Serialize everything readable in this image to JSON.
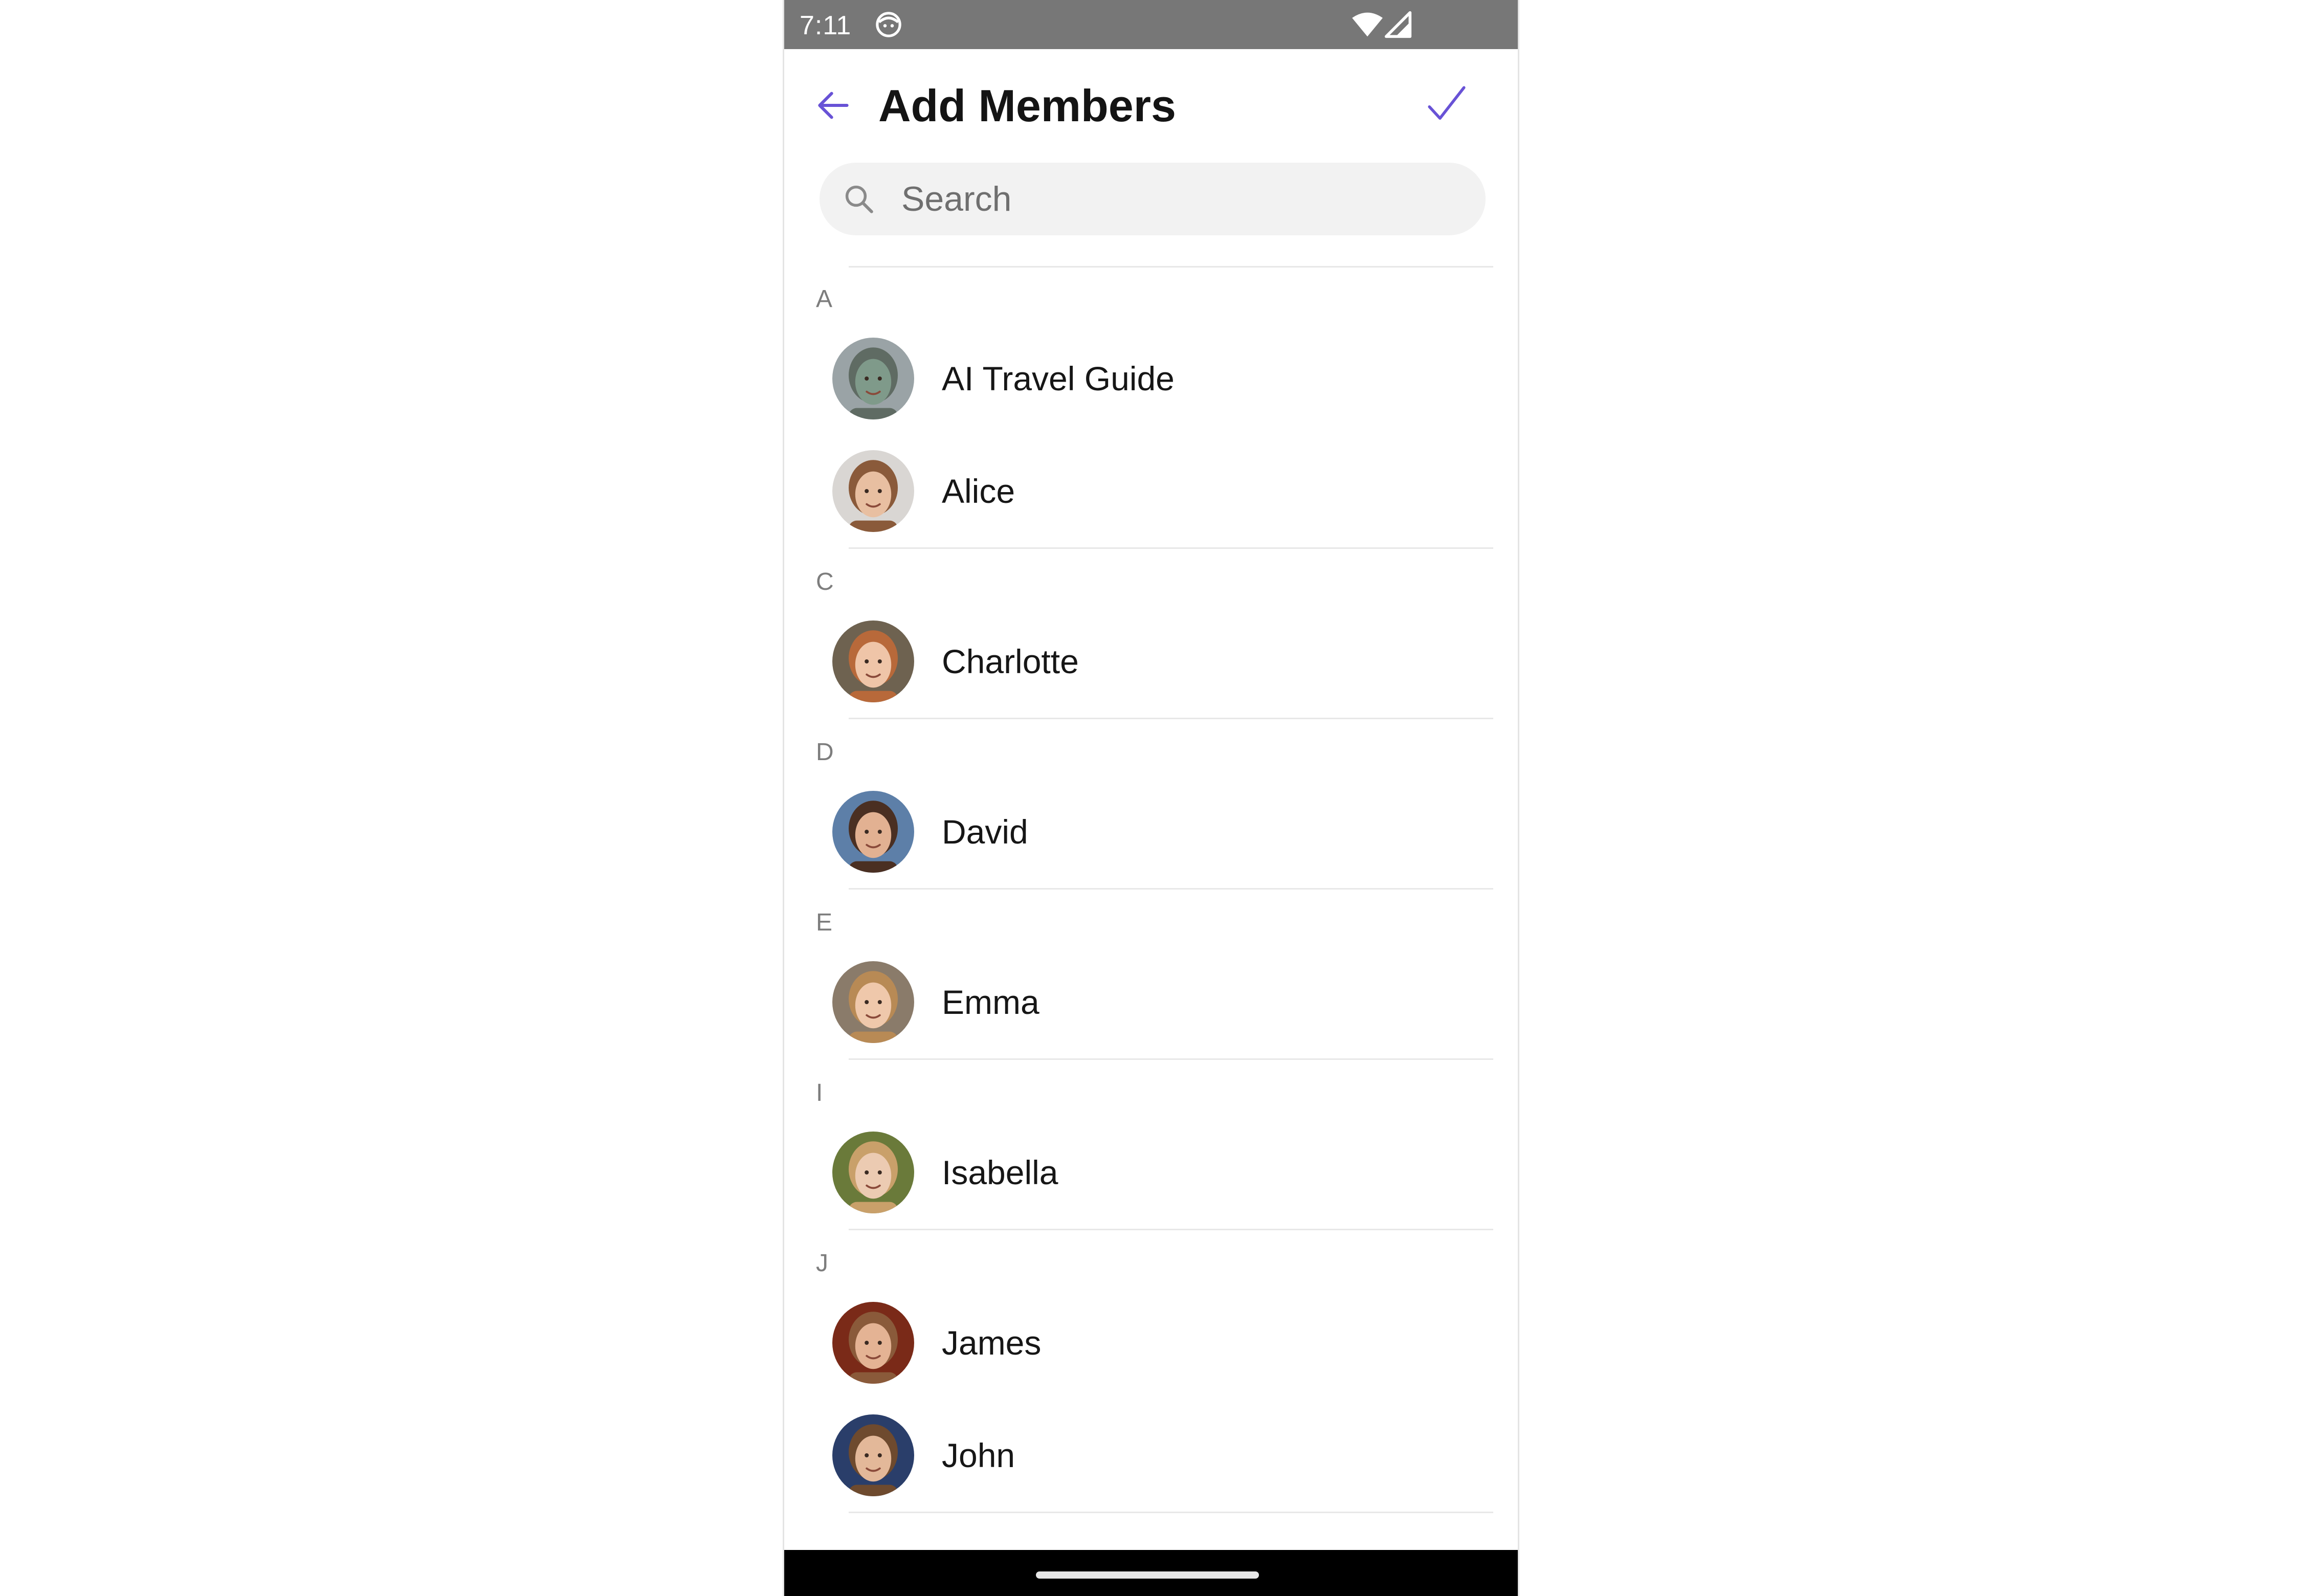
{
  "status_bar": {
    "time": "7:11",
    "icons": [
      "face-notification-icon",
      "wifi-icon",
      "cellular-signal-icon"
    ]
  },
  "header": {
    "back_icon": "arrow-left-icon",
    "title": "Add Members",
    "confirm_icon": "checkmark-icon"
  },
  "search": {
    "placeholder": "Search",
    "value": "",
    "icon": "search-icon"
  },
  "sections": [
    {
      "letter": "A",
      "members": [
        {
          "name": "AI Travel Guide"
        },
        {
          "name": "Alice"
        }
      ]
    },
    {
      "letter": "C",
      "members": [
        {
          "name": "Charlotte"
        }
      ]
    },
    {
      "letter": "D",
      "members": [
        {
          "name": "David"
        }
      ]
    },
    {
      "letter": "E",
      "members": [
        {
          "name": "Emma"
        }
      ]
    },
    {
      "letter": "I",
      "members": [
        {
          "name": "Isabella"
        }
      ]
    },
    {
      "letter": "J",
      "members": [
        {
          "name": "James"
        },
        {
          "name": "John"
        }
      ]
    }
  ],
  "colors": {
    "accent": "#6852d6",
    "status_bar": "#777777",
    "search_bg": "#f2f2f2",
    "section_letter": "#7d7d7d",
    "divider": "#e8e8e8"
  }
}
